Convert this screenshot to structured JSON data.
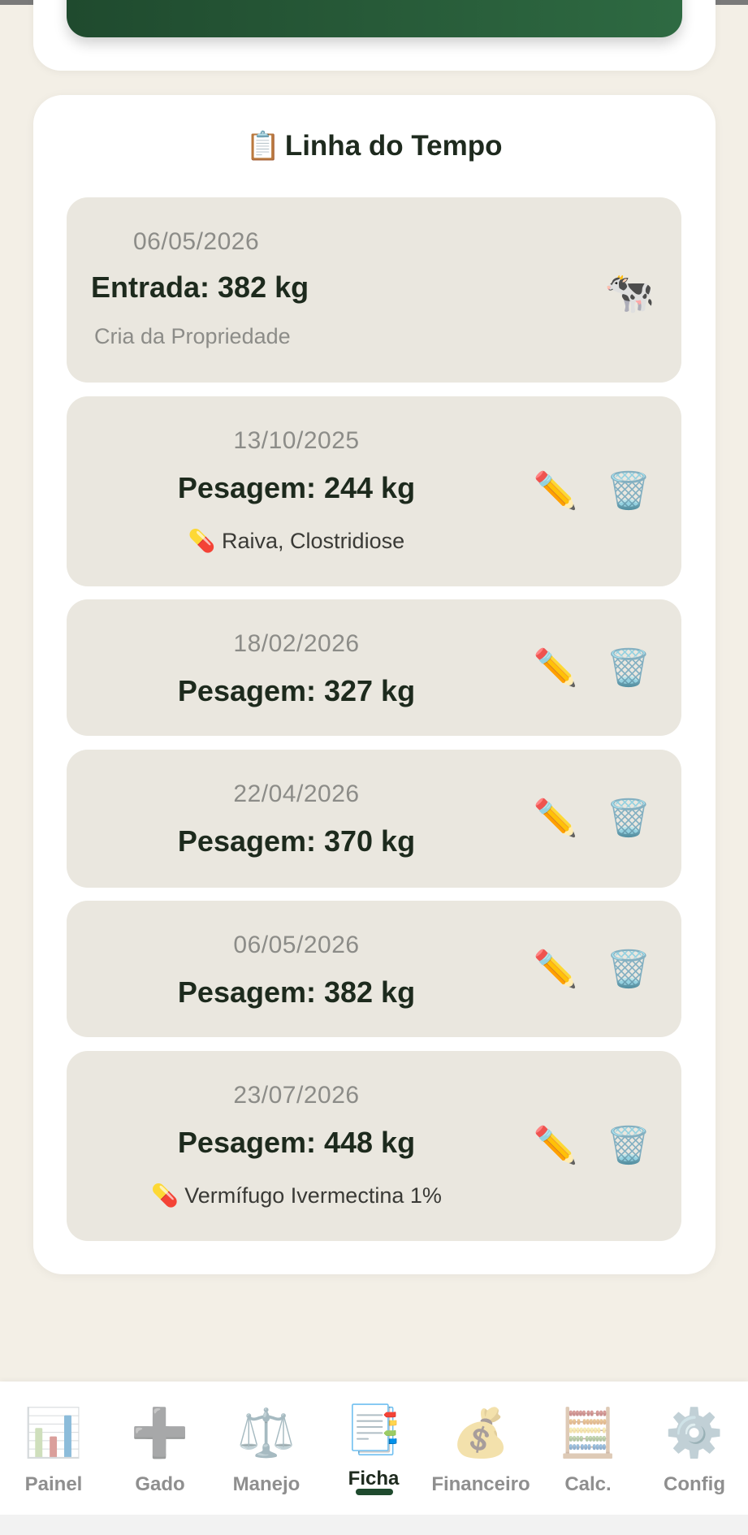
{
  "timeline": {
    "title_icon": "📋",
    "title": "Linha do Tempo",
    "entries": [
      {
        "date": "06/05/2026",
        "main": "Entrada: 382 kg",
        "note": "Cria da Propriedade",
        "icon": "🐄"
      },
      {
        "date": "13/10/2025",
        "main": "Pesagem: 244 kg",
        "note_icon": "💊",
        "note": "Raiva, Clostridiose"
      },
      {
        "date": "18/02/2026",
        "main": "Pesagem: 327 kg"
      },
      {
        "date": "22/04/2026",
        "main": "Pesagem: 370 kg"
      },
      {
        "date": "06/05/2026",
        "main": "Pesagem: 382 kg"
      },
      {
        "date": "23/07/2026",
        "main": "Pesagem: 448 kg",
        "note_icon": "💊",
        "note": "Vermífugo Ivermectina 1%"
      }
    ],
    "edit_icon": "✏️",
    "delete_icon": "🗑️"
  },
  "nav": {
    "items": [
      {
        "label": "Painel",
        "icon": "📊"
      },
      {
        "label": "Gado",
        "icon": "➕"
      },
      {
        "label": "Manejo",
        "icon": "⚖️"
      },
      {
        "label": "Ficha",
        "icon": "📑",
        "active": true
      },
      {
        "label": "Financeiro",
        "icon": "💰"
      },
      {
        "label": "Calc.",
        "icon": "🧮"
      },
      {
        "label": "Config",
        "icon": "⚙️"
      }
    ]
  },
  "colors": {
    "accent": "#1f4a2e",
    "background": "#f3efe6",
    "entry_bg": "#eae7df",
    "text_dark": "#1d2a1d",
    "text_muted": "#8c8c88"
  }
}
